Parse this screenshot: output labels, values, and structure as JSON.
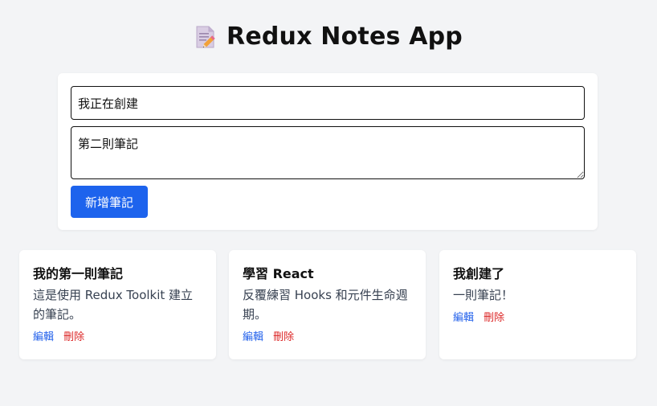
{
  "header": {
    "icon": "memo-icon",
    "title": "Redux Notes App"
  },
  "form": {
    "title_value": "我正在創建",
    "content_value": "第二則筆記",
    "add_button_label": "新增筆記"
  },
  "notes": [
    {
      "title": "我的第一則筆記",
      "content": "這是使用 Redux Toolkit 建立的筆記。",
      "edit_label": "編輯",
      "delete_label": "刪除"
    },
    {
      "title": "學習 React",
      "content": "反覆練習 Hooks 和元件生命週期。",
      "edit_label": "編輯",
      "delete_label": "刪除"
    },
    {
      "title": "我創建了",
      "content": "一則筆記！",
      "edit_label": "編輯",
      "delete_label": "刪除"
    }
  ],
  "colors": {
    "background": "#f3f4f6",
    "primary_button": "#1d63ed",
    "edit_link": "#2563eb",
    "delete_link": "#dc2626"
  }
}
